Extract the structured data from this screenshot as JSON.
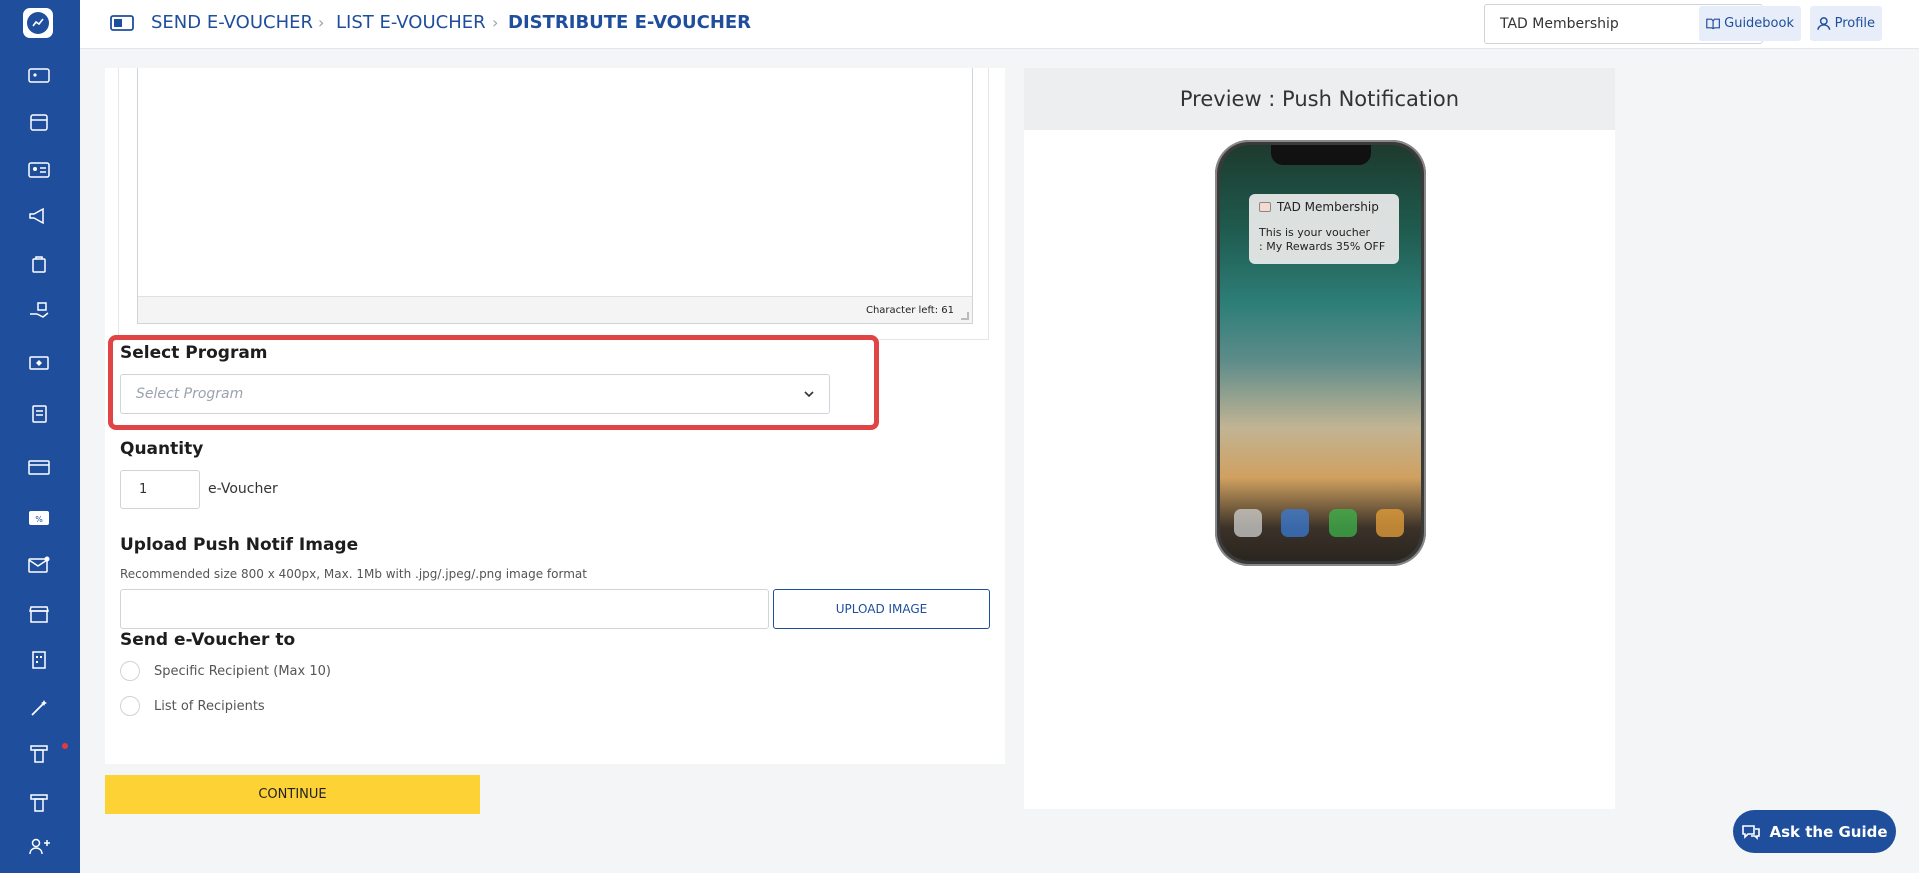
{
  "breadcrumb": {
    "items": [
      "SEND E-VOUCHER",
      "LIST E-VOUCHER",
      "DISTRIBUTE E-VOUCHER"
    ]
  },
  "header": {
    "account_select_value": "TAD Membership",
    "guidebook_label": "Guidebook",
    "profile_label": "Profile"
  },
  "editor": {
    "char_left": "Character left: 61"
  },
  "form": {
    "select_program_label": "Select Program",
    "select_program_placeholder": "Select Program",
    "quantity_label": "Quantity",
    "quantity_value": "1",
    "quantity_unit": "e-Voucher",
    "upload_label": "Upload Push Notif Image",
    "upload_hint": "Recommended size 800 x 400px, Max. 1Mb with .jpg/.jpeg/.png image format",
    "upload_button": "UPLOAD IMAGE",
    "send_to_label": "Send e-Voucher to",
    "recipient_options": [
      "Specific Recipient (Max 10)",
      "List of Recipients"
    ],
    "continue_button": "CONTINUE"
  },
  "preview": {
    "title": "Preview : Push Notification",
    "notification_app": "TAD Membership",
    "notification_line1": "This is your voucher",
    "notification_line2": ": My Rewards 35% OFF"
  },
  "ask_guide_label": "Ask the Guide",
  "colors": {
    "primary": "#1f4e9c",
    "accent_yellow": "#fdd235",
    "highlight_red": "#e04444"
  }
}
